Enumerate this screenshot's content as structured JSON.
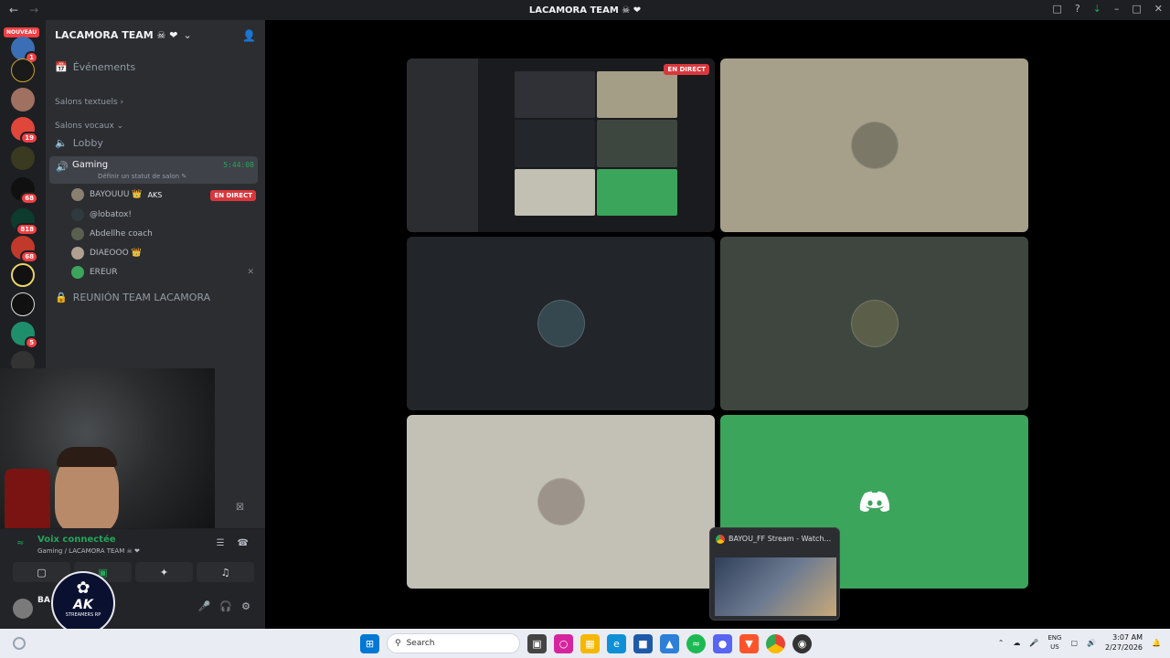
{
  "window": {
    "title": "LACAMORA TEAM ☠ ❤",
    "nav_back": "←",
    "nav_fwd": "→",
    "controls": [
      "–",
      "□",
      "✕"
    ]
  },
  "servers": {
    "nouveau_label": "NOUVEAU",
    "badges": [
      "1",
      "19",
      "68",
      "818",
      "68",
      "5"
    ]
  },
  "guild": {
    "name": "LACAMORA TEAM ☠ ❤",
    "chevron": "⌄",
    "events_label": "Événements",
    "text_category": "Salons textuels ›",
    "voice_category": "Salons vocaux ⌄",
    "channels": {
      "lobby": "Lobby",
      "gaming": "Gaming",
      "gaming_status": "Définir un statut de salon ✎",
      "gaming_time": "5:44:08",
      "locked": "REUNIÓN TEAM LACAMORA"
    },
    "voice_users": [
      {
        "name": "BAYOUUU 👑",
        "extra": "AKS",
        "live": "EN DIRECT"
      },
      {
        "name": "@lobatox!"
      },
      {
        "name": "Abdellhe coach"
      },
      {
        "name": "DIAEOOO 👑"
      },
      {
        "name": "EREUR"
      }
    ]
  },
  "voice_panel": {
    "connected": "Voix connectée",
    "location": "Gaming / LACAMORA TEAM ☠ ❤",
    "user": "BA"
  },
  "ak_logo": {
    "main": "AK",
    "sub": "STREAMERS RP"
  },
  "stage": {
    "live_label": "EN DIRECT"
  },
  "preview": {
    "title": "BAYOU_FF Stream - Watch..."
  },
  "taskbar": {
    "search_placeholder": "Search",
    "lang": "ENG",
    "region": "US",
    "time": "3:07 AM",
    "date": "2/27/2026"
  },
  "colors": {
    "accent_green": "#23a55a",
    "live_red": "#da373c",
    "discord_green": "#3ba55c"
  }
}
